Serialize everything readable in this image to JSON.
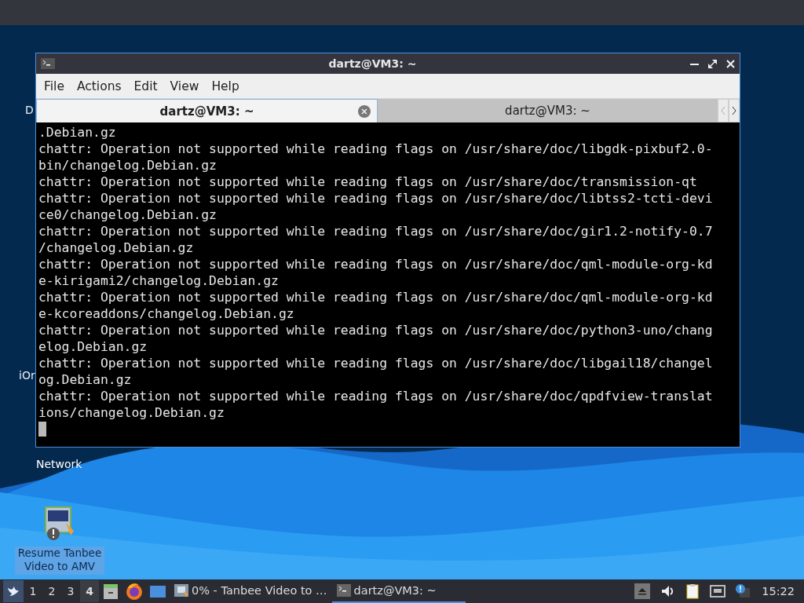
{
  "desktop": {
    "partial_labels": [
      "D",
      "iOr"
    ],
    "network_label": "Network",
    "shortcut": {
      "label": "Resume Tanbee Video to AMV"
    }
  },
  "window": {
    "title": "dartz@VM3: ~",
    "menu": [
      "File",
      "Actions",
      "Edit",
      "View",
      "Help"
    ],
    "tabs": [
      {
        "label": "dartz@VM3: ~",
        "selected": true
      },
      {
        "label": "dartz@VM3: ~",
        "selected": false
      }
    ],
    "terminal_lines": [
      ".Debian.gz",
      "chattr: Operation not supported while reading flags on /usr/share/doc/libgdk-pixbuf2.0-",
      "bin/changelog.Debian.gz",
      "chattr: Operation not supported while reading flags on /usr/share/doc/transmission-qt",
      "chattr: Operation not supported while reading flags on /usr/share/doc/libtss2-tcti-devi",
      "ce0/changelog.Debian.gz",
      "chattr: Operation not supported while reading flags on /usr/share/doc/gir1.2-notify-0.7",
      "/changelog.Debian.gz",
      "chattr: Operation not supported while reading flags on /usr/share/doc/qml-module-org-kd",
      "e-kirigami2/changelog.Debian.gz",
      "chattr: Operation not supported while reading flags on /usr/share/doc/qml-module-org-kd",
      "e-kcoreaddons/changelog.Debian.gz",
      "chattr: Operation not supported while reading flags on /usr/share/doc/python3-uno/chang",
      "elog.Debian.gz",
      "chattr: Operation not supported while reading flags on /usr/share/doc/libgail18/changel",
      "og.Debian.gz",
      "chattr: Operation not supported while reading flags on /usr/share/doc/qpdfview-translat",
      "ions/changelog.Debian.gz"
    ]
  },
  "taskbar": {
    "workspaces": [
      {
        "label": "1",
        "selected": false
      },
      {
        "label": "2",
        "selected": false
      },
      {
        "label": "3",
        "selected": false
      },
      {
        "label": "4",
        "selected": true
      }
    ],
    "tasks": [
      {
        "label": "0% - Tanbee Video to …",
        "selected": false,
        "kind": "video"
      },
      {
        "label": "dartz@VM3: ~",
        "selected": true,
        "kind": "terminal"
      }
    ],
    "clock": "15:22"
  }
}
